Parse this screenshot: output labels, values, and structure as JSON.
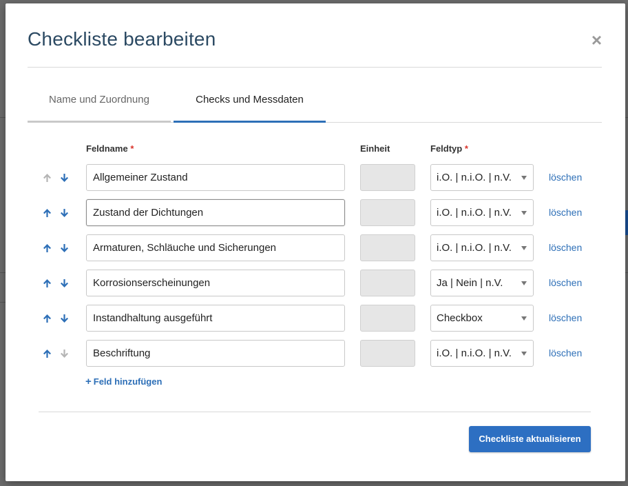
{
  "modal": {
    "title": "Checkliste bearbeiten",
    "close_symbol": "×"
  },
  "tabs": [
    {
      "label": "Name und Zuordnung",
      "active": false
    },
    {
      "label": "Checks und Messdaten",
      "active": true
    }
  ],
  "columns": {
    "name": "Feldname",
    "unit": "Einheit",
    "type": "Feldtyp",
    "required_marker": "*"
  },
  "rows": [
    {
      "name": "Allgemeiner Zustand",
      "unit": "",
      "type": "i.O. | n.i.O. | n.V.",
      "delete": "löschen",
      "up_enabled": false,
      "down_enabled": true
    },
    {
      "name": "Zustand der Dichtungen",
      "unit": "",
      "type": "i.O. | n.i.O. | n.V.",
      "delete": "löschen",
      "up_enabled": true,
      "down_enabled": true,
      "focused": true
    },
    {
      "name": "Armaturen, Schläuche und Sicherungen",
      "unit": "",
      "type": "i.O. | n.i.O. | n.V.",
      "delete": "löschen",
      "up_enabled": true,
      "down_enabled": true
    },
    {
      "name": "Korrosionserscheinungen",
      "unit": "",
      "type": "Ja | Nein | n.V.",
      "delete": "löschen",
      "up_enabled": true,
      "down_enabled": true
    },
    {
      "name": "Instandhaltung ausgeführt",
      "unit": "",
      "type": "Checkbox",
      "delete": "löschen",
      "up_enabled": true,
      "down_enabled": true
    },
    {
      "name": "Beschriftung",
      "unit": "",
      "type": "i.O. | n.i.O. | n.V.",
      "delete": "löschen",
      "up_enabled": true,
      "down_enabled": false
    }
  ],
  "add_field": {
    "icon": "plus-icon",
    "label": "Feld hinzufügen"
  },
  "submit_label": "Checkliste aktualisieren",
  "colors": {
    "accent": "#2d6fb7",
    "button": "#2d6fc2",
    "title": "#2c4a63",
    "required": "#d9342b",
    "arrow_enabled": "#2d6fb7",
    "arrow_disabled": "#b5b5b5"
  }
}
